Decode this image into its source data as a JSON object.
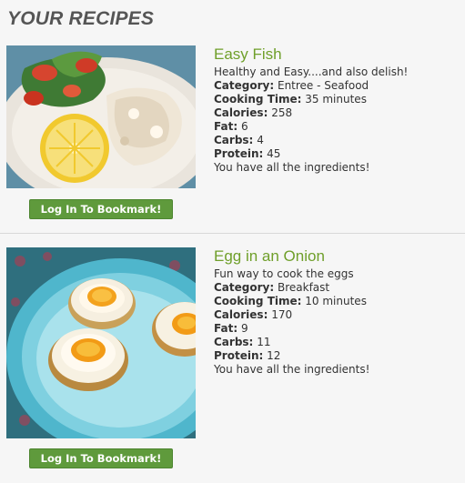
{
  "page": {
    "title": "YOUR RECIPES"
  },
  "recipes": [
    {
      "name": "Easy Fish",
      "description": "Healthy and Easy....and also delish!",
      "category_label": "Category:",
      "category": "Entree - Seafood",
      "cooking_time_label": "Cooking Time:",
      "cooking_time": "35 minutes",
      "calories_label": "Calories:",
      "calories": "258",
      "fat_label": "Fat:",
      "fat": "6",
      "carbs_label": "Carbs:",
      "carbs": "4",
      "protein_label": "Protein:",
      "protein": "45",
      "ingredients_status": "You have all the ingredients!",
      "bookmark_label": "Log In To Bookmark!"
    },
    {
      "name": "Egg in an Onion",
      "description": "Fun way to cook the eggs",
      "category_label": "Category:",
      "category": "Breakfast",
      "cooking_time_label": "Cooking Time:",
      "cooking_time": "10 minutes",
      "calories_label": "Calories:",
      "calories": "170",
      "fat_label": "Fat:",
      "fat": "9",
      "carbs_label": "Carbs:",
      "carbs": "11",
      "protein_label": "Protein:",
      "protein": "12",
      "ingredients_status": "You have all the ingredients!",
      "bookmark_label": "Log In To Bookmark!"
    }
  ],
  "colors": {
    "title": "#555555",
    "recipe_link": "#6f9f2a",
    "button": "#5f9a3c",
    "background": "#f6f6f6"
  }
}
